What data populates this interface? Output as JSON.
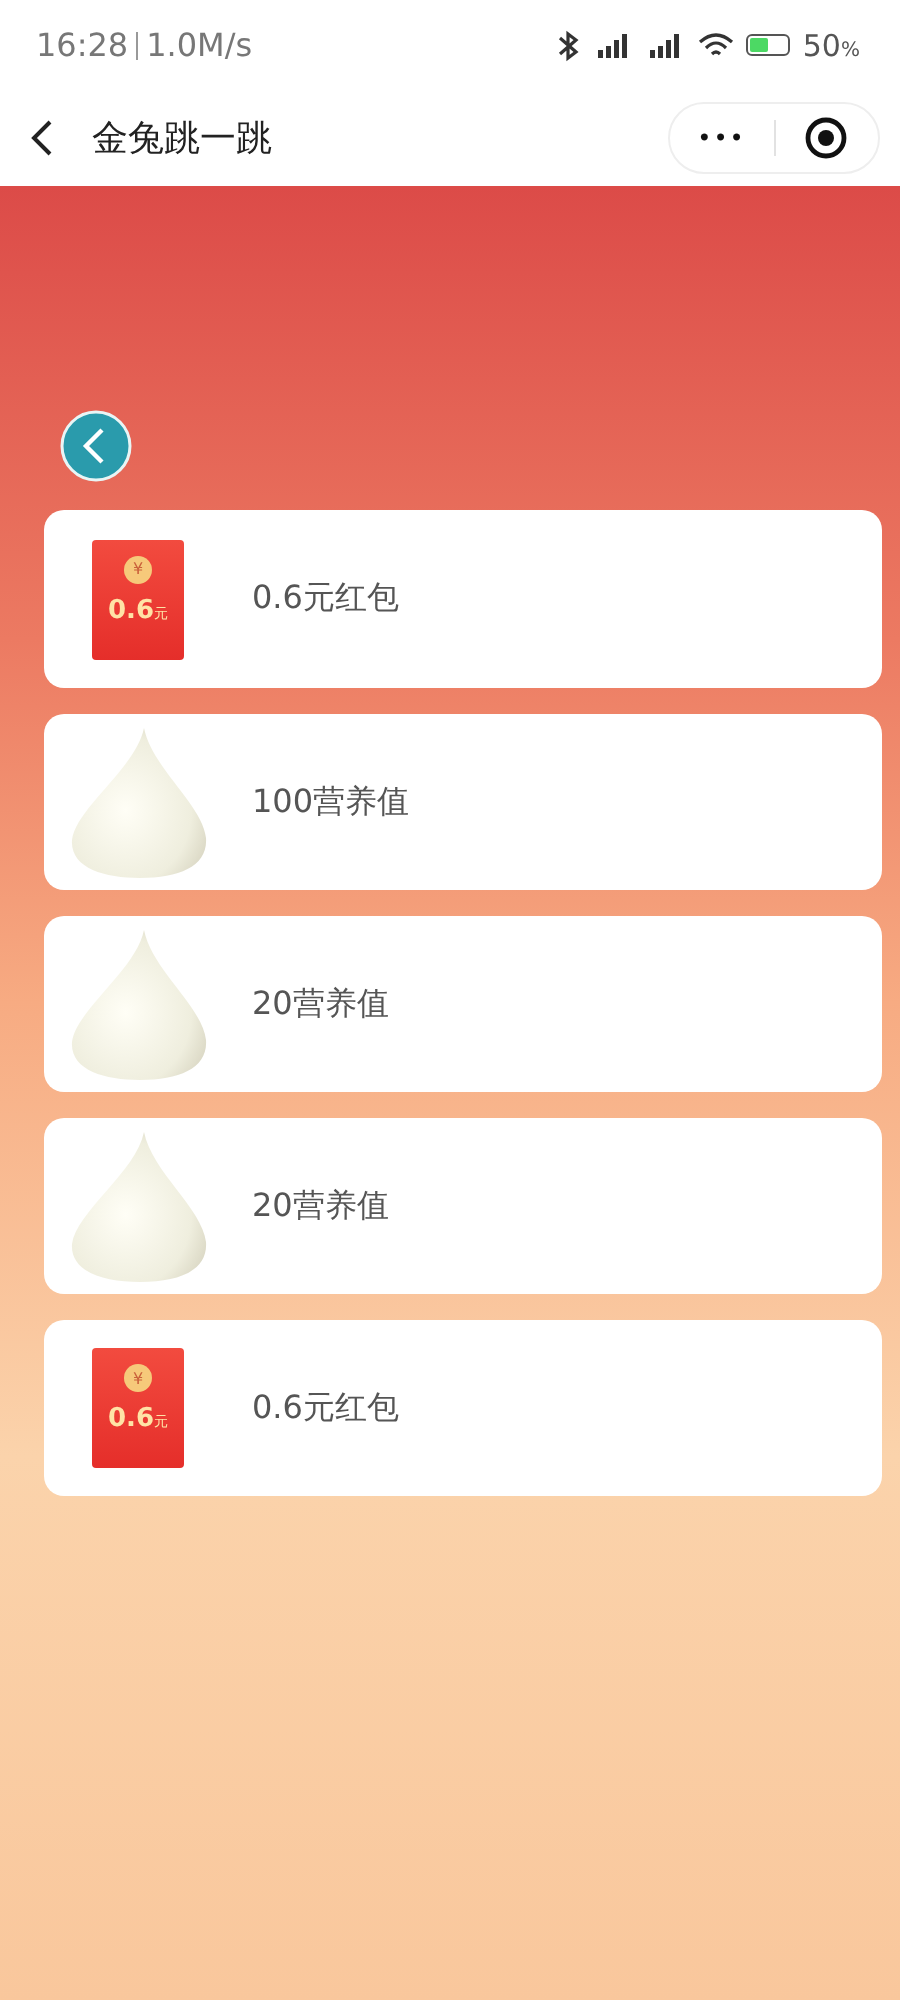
{
  "status_bar": {
    "time": "16:28",
    "speed": "1.0M/s",
    "battery_percent": "50",
    "battery_unit": "%"
  },
  "nav": {
    "title": "金兔跳一跳",
    "more": "•••"
  },
  "rewards": [
    {
      "kind": "red_packet",
      "label": "0.6元红包",
      "amount": "0.6",
      "unit": "元",
      "coin": "¥"
    },
    {
      "kind": "drop",
      "label": "100营养值"
    },
    {
      "kind": "drop",
      "label": "20营养值"
    },
    {
      "kind": "drop",
      "label": "20营养值"
    },
    {
      "kind": "red_packet",
      "label": "0.6元红包",
      "amount": "0.6",
      "unit": "元",
      "coin": "¥"
    }
  ]
}
